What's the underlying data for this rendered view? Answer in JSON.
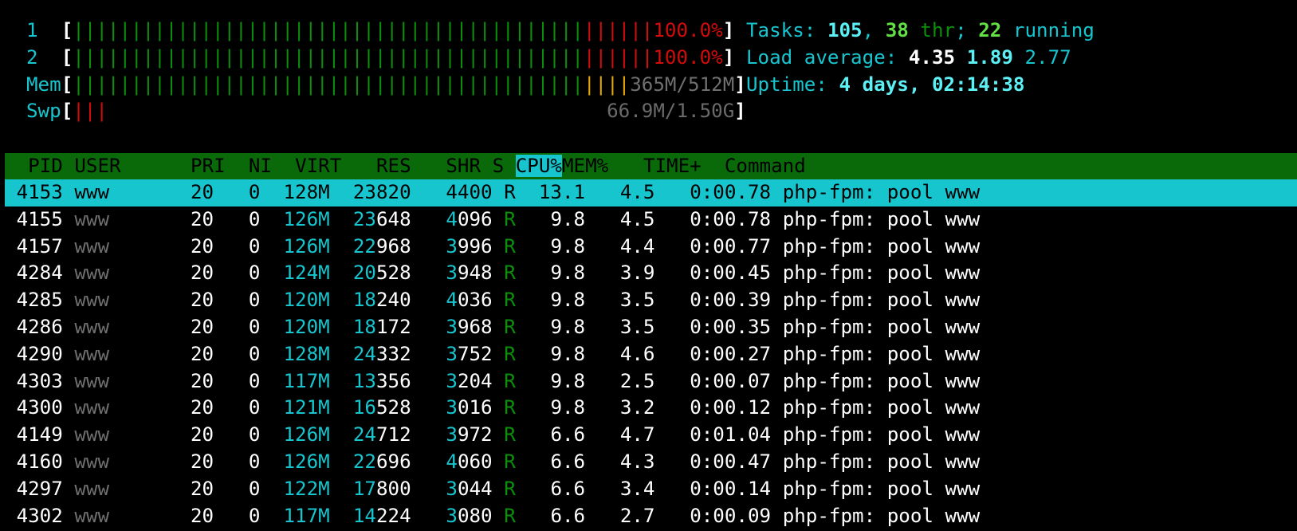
{
  "meters": {
    "cpu1": {
      "label": "1",
      "bar_green": "||||||||||||||||||||||||||||||||||||||||||||",
      "bar_red": "||||||",
      "value": "100.0%"
    },
    "cpu2": {
      "label": "2",
      "bar_green": "||||||||||||||||||||||||||||||||||||||||||||",
      "bar_red": "||||||",
      "value": "100.0%"
    },
    "mem": {
      "label": "Mem",
      "bar_green": "||||||||||||||||||||||||||||||||||||||||||||",
      "bar_yellow": "||||",
      "value": "365M/512M"
    },
    "swp": {
      "label": "Swp",
      "bar_red": "|||",
      "value": "66.9M/1.50G"
    }
  },
  "summary": {
    "tasks_label": "Tasks: ",
    "tasks": "105",
    "threads": "38",
    "thr_label": " thr",
    "running": "22",
    "running_label": " running",
    "load_label": "Load average: ",
    "load1": "4.35",
    "load5": "1.89",
    "load15": "2.77",
    "uptime_label": "Uptime: ",
    "uptime": "4 days, 02:14:38"
  },
  "columns": {
    "pid": "PID",
    "user": "USER",
    "pri": "PRI",
    "ni": "NI",
    "virt": "VIRT",
    "res": "RES",
    "shr": "SHR",
    "s": "S",
    "cpu": "CPU%",
    "mem": "MEM%",
    "time": "TIME+",
    "command": "Command"
  },
  "processes": [
    {
      "pid": "4153",
      "user": "www",
      "pri": "20",
      "ni": "0",
      "virt": "128M",
      "res_hi": "",
      "res_lo": "23820",
      "shr_hi": "",
      "shr_lo": "4400",
      "s": "R",
      "cpu": "13.1",
      "mem": "4.5",
      "time": "0:00.78",
      "command": "php-fpm: pool www"
    },
    {
      "pid": "4155",
      "user": "www",
      "pri": "20",
      "ni": "0",
      "virt": "126M",
      "res_hi": "23",
      "res_lo": "648",
      "shr_hi": "4",
      "shr_lo": "096",
      "s": "R",
      "cpu": "9.8",
      "mem": "4.5",
      "time": "0:00.78",
      "command": "php-fpm: pool www"
    },
    {
      "pid": "4157",
      "user": "www",
      "pri": "20",
      "ni": "0",
      "virt": "126M",
      "res_hi": "22",
      "res_lo": "968",
      "shr_hi": "3",
      "shr_lo": "996",
      "s": "R",
      "cpu": "9.8",
      "mem": "4.4",
      "time": "0:00.77",
      "command": "php-fpm: pool www"
    },
    {
      "pid": "4284",
      "user": "www",
      "pri": "20",
      "ni": "0",
      "virt": "124M",
      "res_hi": "20",
      "res_lo": "528",
      "shr_hi": "3",
      "shr_lo": "948",
      "s": "R",
      "cpu": "9.8",
      "mem": "3.9",
      "time": "0:00.45",
      "command": "php-fpm: pool www"
    },
    {
      "pid": "4285",
      "user": "www",
      "pri": "20",
      "ni": "0",
      "virt": "120M",
      "res_hi": "18",
      "res_lo": "240",
      "shr_hi": "4",
      "shr_lo": "036",
      "s": "R",
      "cpu": "9.8",
      "mem": "3.5",
      "time": "0:00.39",
      "command": "php-fpm: pool www"
    },
    {
      "pid": "4286",
      "user": "www",
      "pri": "20",
      "ni": "0",
      "virt": "120M",
      "res_hi": "18",
      "res_lo": "172",
      "shr_hi": "3",
      "shr_lo": "968",
      "s": "R",
      "cpu": "9.8",
      "mem": "3.5",
      "time": "0:00.35",
      "command": "php-fpm: pool www"
    },
    {
      "pid": "4290",
      "user": "www",
      "pri": "20",
      "ni": "0",
      "virt": "128M",
      "res_hi": "24",
      "res_lo": "332",
      "shr_hi": "3",
      "shr_lo": "752",
      "s": "R",
      "cpu": "9.8",
      "mem": "4.6",
      "time": "0:00.27",
      "command": "php-fpm: pool www"
    },
    {
      "pid": "4303",
      "user": "www",
      "pri": "20",
      "ni": "0",
      "virt": "117M",
      "res_hi": "13",
      "res_lo": "356",
      "shr_hi": "3",
      "shr_lo": "204",
      "s": "R",
      "cpu": "9.8",
      "mem": "2.5",
      "time": "0:00.07",
      "command": "php-fpm: pool www"
    },
    {
      "pid": "4300",
      "user": "www",
      "pri": "20",
      "ni": "0",
      "virt": "121M",
      "res_hi": "16",
      "res_lo": "528",
      "shr_hi": "3",
      "shr_lo": "016",
      "s": "R",
      "cpu": "9.8",
      "mem": "3.2",
      "time": "0:00.12",
      "command": "php-fpm: pool www"
    },
    {
      "pid": "4149",
      "user": "www",
      "pri": "20",
      "ni": "0",
      "virt": "126M",
      "res_hi": "24",
      "res_lo": "712",
      "shr_hi": "3",
      "shr_lo": "972",
      "s": "R",
      "cpu": "6.6",
      "mem": "4.7",
      "time": "0:01.04",
      "command": "php-fpm: pool www"
    },
    {
      "pid": "4160",
      "user": "www",
      "pri": "20",
      "ni": "0",
      "virt": "126M",
      "res_hi": "22",
      "res_lo": "696",
      "shr_hi": "4",
      "shr_lo": "060",
      "s": "R",
      "cpu": "6.6",
      "mem": "4.3",
      "time": "0:00.47",
      "command": "php-fpm: pool www"
    },
    {
      "pid": "4297",
      "user": "www",
      "pri": "20",
      "ni": "0",
      "virt": "122M",
      "res_hi": "17",
      "res_lo": "800",
      "shr_hi": "3",
      "shr_lo": "044",
      "s": "R",
      "cpu": "6.6",
      "mem": "3.4",
      "time": "0:00.14",
      "command": "php-fpm: pool www"
    },
    {
      "pid": "4302",
      "user": "www",
      "pri": "20",
      "ni": "0",
      "virt": "117M",
      "res_hi": "14",
      "res_lo": "224",
      "shr_hi": "3",
      "shr_lo": "080",
      "s": "R",
      "cpu": "6.6",
      "mem": "2.7",
      "time": "0:00.09",
      "command": "php-fpm: pool www"
    }
  ],
  "colors": {
    "cyan": "#17c5cf",
    "green_bar": "#0b8f0b",
    "red_bar": "#d20b0b",
    "yellow_bar": "#e6a800",
    "header_bg": "#0a6a0a"
  }
}
